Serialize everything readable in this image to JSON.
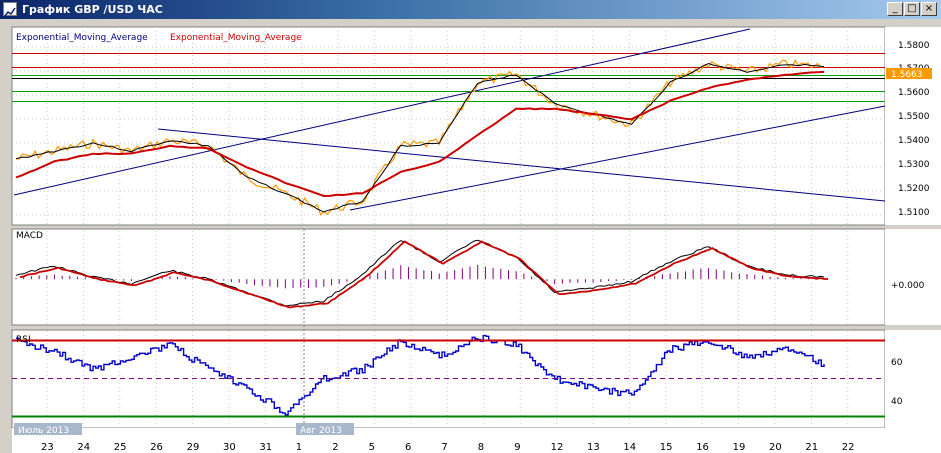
{
  "window": {
    "title": "График GBP /USD  ЧАС",
    "buttons": {
      "minimize": "_",
      "maximize": "□",
      "close": "×"
    }
  },
  "price_panel": {
    "indicator_label_1": "Exponential_Moving_Average",
    "indicator_label_2": "Exponential_Moving_Average",
    "current_price": "1.5663",
    "y_ticks": [
      "1.5800",
      "1.5700",
      "1.5600",
      "1.5500",
      "1.5400",
      "1.5300",
      "1.5200",
      "1.5100"
    ]
  },
  "macd_panel": {
    "label": "MACD",
    "zero_label": "+0.000"
  },
  "rsi_panel": {
    "label": "RSI",
    "y_ticks": [
      "60",
      "40"
    ]
  },
  "time_axis": {
    "date_labels": [
      "23",
      "24",
      "25",
      "26",
      "29",
      "30",
      "31",
      "1",
      "2",
      "5",
      "6",
      "7",
      "8",
      "9",
      "12",
      "13",
      "14",
      "15",
      "16",
      "19",
      "20",
      "21",
      "22"
    ],
    "month_labels": [
      "Июль 2013",
      "Авг 2013"
    ]
  },
  "colors": {
    "price_line": "#ff9900",
    "ema_fast": "#000000",
    "ema_slow": "#cc0000",
    "trendline": "#000080",
    "resistance_lines": "#cc0000",
    "support_lines": "#00a000",
    "rsi_line": "#0000cc",
    "histogram": "#800080",
    "current_price_tag": "#ff9900"
  },
  "chart_data": [
    {
      "type": "line",
      "title": "",
      "series": [
        {
          "name": "Exponential_Moving_Average",
          "values": [
            1.533,
            1.536,
            1.539,
            1.536,
            1.54,
            1.538,
            1.526,
            1.52,
            1.513,
            1.517,
            1.538,
            1.539,
            1.562,
            1.565,
            1.554,
            1.55,
            1.546,
            1.562,
            1.569,
            1.566,
            1.569,
            1.568
          ]
        },
        {
          "name": "Exponential_Moving_Average",
          "values": [
            1.526,
            1.532,
            1.535,
            1.535,
            1.538,
            1.537,
            1.53,
            1.524,
            1.519,
            1.52,
            1.528,
            1.532,
            1.542,
            1.552,
            1.552,
            1.55,
            1.548,
            1.555,
            1.56,
            1.563,
            1.565,
            1.566
          ]
        }
      ],
      "last_value": 1.5663,
      "ylim": [
        1.508,
        1.583
      ]
    },
    {
      "type": "line",
      "title": "",
      "series": [
        {
          "name": "MACD",
          "values": [
            0.1,
            0.3,
            0.05,
            -0.1,
            0.2,
            0.0,
            -0.3,
            -0.6,
            -0.5,
            0.1,
            0.9,
            0.4,
            0.9,
            0.5,
            -0.3,
            -0.2,
            -0.05,
            0.4,
            0.75,
            0.3,
            0.1,
            0.05
          ]
        }
      ],
      "ylim": [
        -1.0,
        1.1
      ]
    },
    {
      "type": "line",
      "title": "",
      "series": [
        {
          "name": "RSI",
          "values": [
            70,
            65,
            55,
            62,
            68,
            55,
            45,
            32,
            50,
            55,
            70,
            62,
            72,
            68,
            50,
            45,
            42,
            66,
            70,
            62,
            66,
            58
          ]
        }
      ],
      "ylim": [
        25,
        75
      ]
    }
  ]
}
